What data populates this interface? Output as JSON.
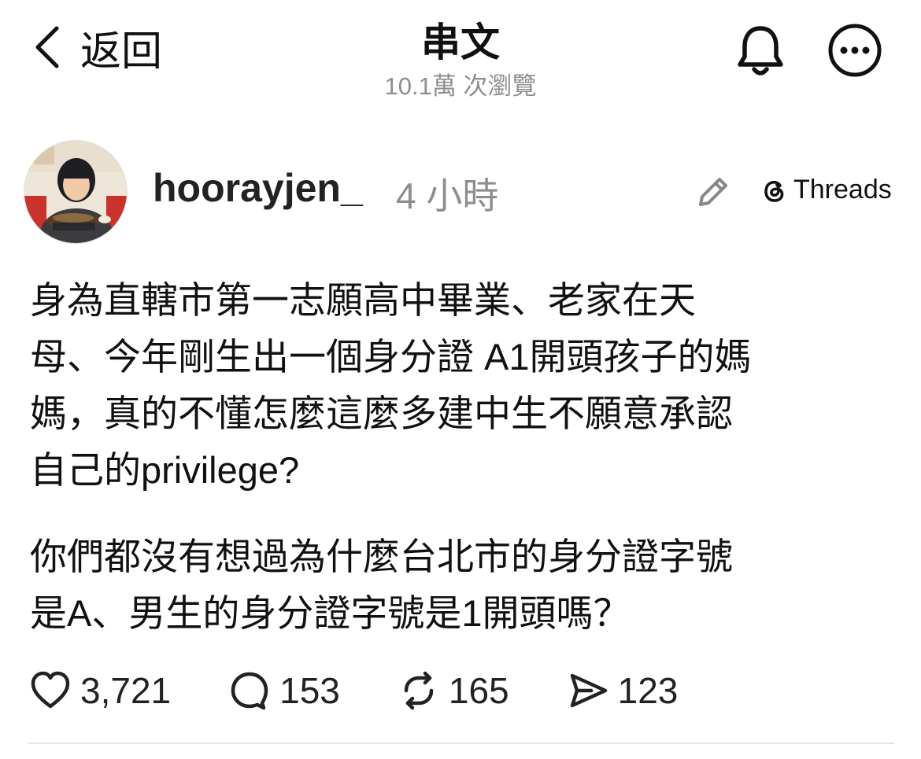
{
  "header": {
    "back_label": "返回",
    "title": "串文",
    "views": "10.1萬 次瀏覽"
  },
  "post": {
    "username": "hoorayjen_",
    "time": "4 小時",
    "source_label": "Threads",
    "paragraph_1": "身為直轄市第一志願高中畢業、老家在天\n母、今年剛生出一個身分證 A1開頭孩子的媽\n媽，真的不懂怎麼這麼多建中生不願意承認\n自己的privilege?",
    "paragraph_2": "你們都沒有想過為什麼台北市的身分證字號\n是A、男生的身分證字號是1開頭嗎？"
  },
  "actions": {
    "likes": "3,721",
    "replies": "153",
    "reposts": "165",
    "shares": "123"
  },
  "icons": {
    "back": "chevron-left-icon",
    "bell": "bell-icon",
    "more": "more-icon",
    "edit": "pencil-icon",
    "threads": "threads-logo-icon",
    "like": "heart-icon",
    "reply": "comment-icon",
    "repost": "repost-icon",
    "share": "send-icon"
  }
}
